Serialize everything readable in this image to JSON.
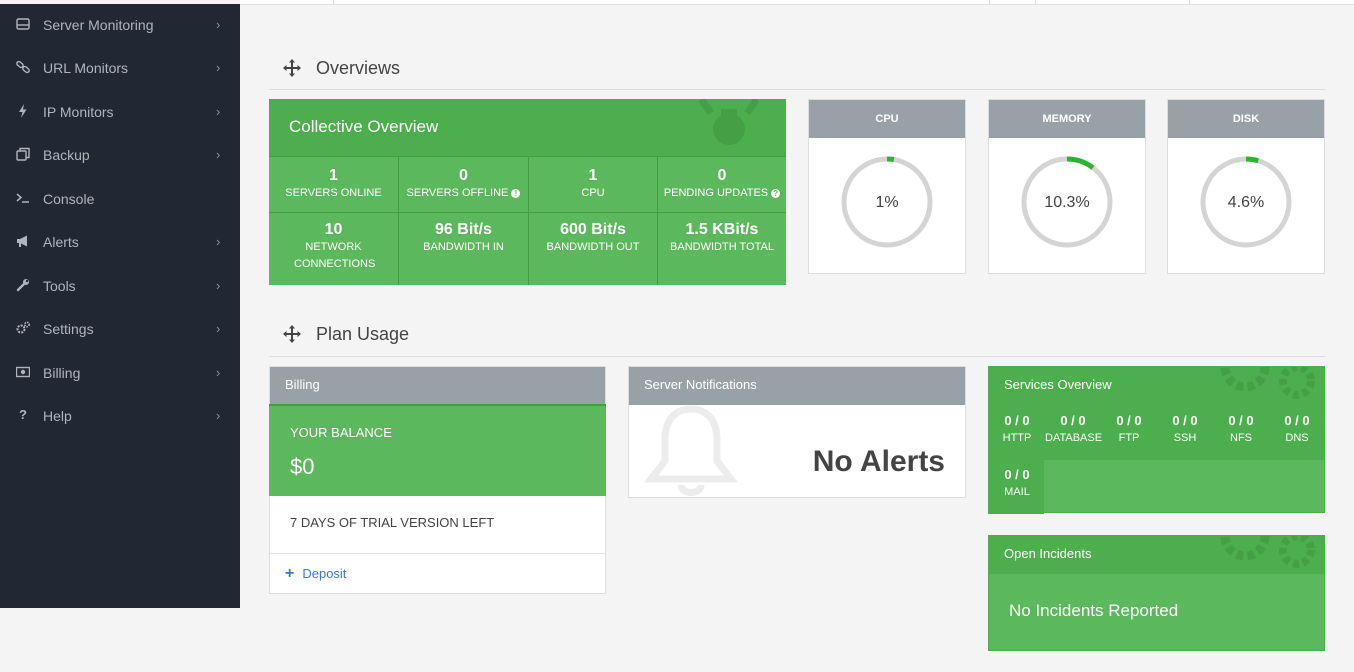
{
  "sidebar": {
    "items": [
      {
        "label": "Server Monitoring",
        "icon": "server-icon",
        "has_children": true
      },
      {
        "label": "URL Monitors",
        "icon": "link-icon",
        "has_children": true
      },
      {
        "label": "IP Monitors",
        "icon": "bolt-icon",
        "has_children": true
      },
      {
        "label": "Backup",
        "icon": "backup-icon",
        "has_children": true
      },
      {
        "label": "Console",
        "icon": "terminal-icon",
        "has_children": false
      },
      {
        "label": "Alerts",
        "icon": "bullhorn-icon",
        "has_children": true
      },
      {
        "label": "Tools",
        "icon": "wrench-icon",
        "has_children": true
      },
      {
        "label": "Settings",
        "icon": "gears-icon",
        "has_children": true
      },
      {
        "label": "Billing",
        "icon": "money-icon",
        "has_children": true
      },
      {
        "label": "Help",
        "icon": "question-icon",
        "has_children": true
      }
    ],
    "chevron": "›"
  },
  "overviews": {
    "title": "Overviews",
    "collective": {
      "title": "Collective Overview",
      "stats": [
        {
          "value": "1",
          "label": "SERVERS ONLINE"
        },
        {
          "value": "0",
          "label": "SERVERS OFFLINE",
          "info_icon": "exclamation-circle-icon"
        },
        {
          "value": "1",
          "label": "CPU"
        },
        {
          "value": "0",
          "label": "PENDING UPDATES",
          "info_icon": "question-circle-icon"
        },
        {
          "value": "10",
          "label": "NETWORK CONNECTIONS"
        },
        {
          "value": "96 Bit/s",
          "label": "BANDWIDTH IN"
        },
        {
          "value": "600 Bit/s",
          "label": "BANDWIDTH OUT"
        },
        {
          "value": "1.5 KBit/s",
          "label": "BANDWIDTH TOTAL"
        }
      ]
    },
    "gauges": [
      {
        "title": "CPU",
        "value": "1%",
        "fraction": 0.01
      },
      {
        "title": "MEMORY",
        "value": "10.3%",
        "fraction": 0.103
      },
      {
        "title": "DISK",
        "value": "4.6%",
        "fraction": 0.046
      }
    ]
  },
  "plan_usage": {
    "title": "Plan Usage",
    "billing": {
      "title": "Billing",
      "balance_label": "YOUR BALANCE",
      "balance_value": "$0",
      "trial_text": "7 DAYS OF TRIAL VERSION LEFT",
      "deposit_label": "Deposit"
    },
    "notifications": {
      "title": "Server Notifications",
      "empty_text": "No Alerts"
    },
    "services": {
      "title": "Services Overview",
      "items": [
        {
          "value": "0 / 0",
          "label": "HTTP"
        },
        {
          "value": "0 / 0",
          "label": "DATABASE"
        },
        {
          "value": "0 / 0",
          "label": "FTP"
        },
        {
          "value": "0 / 0",
          "label": "SSH"
        },
        {
          "value": "0 / 0",
          "label": "NFS"
        },
        {
          "value": "0 / 0",
          "label": "DNS"
        },
        {
          "value": "0 / 0",
          "label": "MAIL"
        }
      ]
    },
    "incidents": {
      "title": "Open Incidents",
      "empty_text": "No Incidents Reported"
    }
  },
  "colors": {
    "sidebar_bg": "#222833",
    "green": "#5cb85c",
    "green_dark": "#4cae4c",
    "panel_gray": "#98a2a6",
    "gauge_arc": "#2db32d",
    "gauge_track": "#d4d4d4",
    "link_blue": "#3a7bbf"
  }
}
